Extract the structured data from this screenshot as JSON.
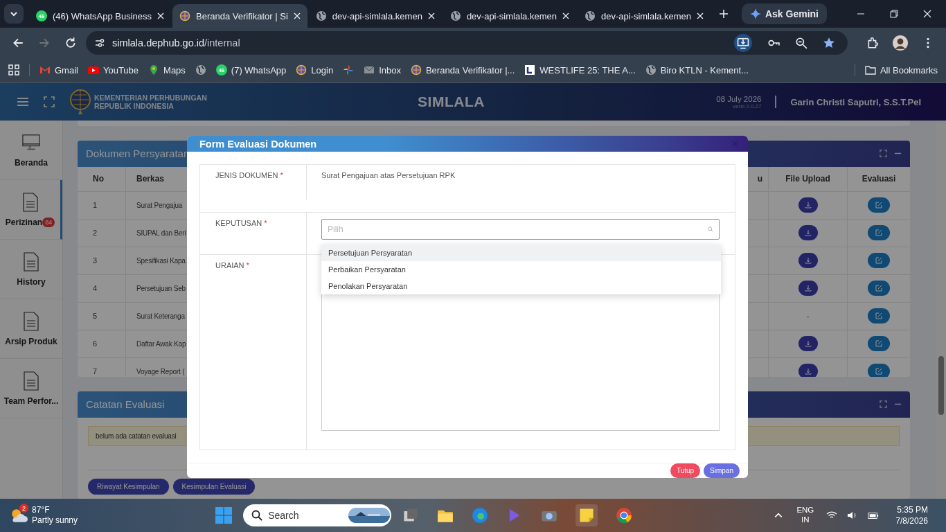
{
  "browser": {
    "tabs": [
      {
        "title": "(46) WhatsApp Business",
        "kind": "whatsapp",
        "badge": "46",
        "selected": false
      },
      {
        "title": "Beranda Verifikator | Si",
        "kind": "emblem",
        "selected": true
      },
      {
        "title": "dev-api-simlala.kemen",
        "kind": "globe",
        "selected": false
      },
      {
        "title": "dev-api-simlala.kemen",
        "kind": "globe",
        "selected": false
      },
      {
        "title": "dev-api-simlala.kemen",
        "kind": "globe",
        "selected": false
      }
    ],
    "gemini": "Ask Gemini",
    "url_host": "simlala.dephub.go.id",
    "url_path": "/internal",
    "bookmarks": [
      {
        "label": "Gmail",
        "kind": "gmail"
      },
      {
        "label": "YouTube",
        "kind": "youtube"
      },
      {
        "label": "Maps",
        "kind": "maps"
      },
      {
        "kind": "globe"
      },
      {
        "label": "(7) WhatsApp",
        "kind": "whatsapp",
        "badge": "46"
      },
      {
        "label": "Login",
        "kind": "emblem"
      },
      {
        "kind": "pinwheel"
      },
      {
        "label": "Inbox",
        "kind": "mail"
      },
      {
        "label": "Beranda Verifikator |...",
        "kind": "emblem"
      },
      {
        "label": "WESTLIFE 25: THE A...",
        "kind": "logo"
      },
      {
        "label": "Biro KTLN - Kement...",
        "kind": "globe"
      }
    ],
    "all_bookmarks": "All Bookmarks"
  },
  "header": {
    "org_line1": "KEMENTERIAN PERHUBUNGAN",
    "org_line2": "REPUBLIK INDONESIA",
    "app_title": "SIMLALA",
    "date": "08 July 2026",
    "version": "versi 2.0.27",
    "user": "Garin Christi Saputri, S.S.T.Pel"
  },
  "sidebar": {
    "items": [
      {
        "label": "Beranda",
        "kind": "monitor",
        "selected": false
      },
      {
        "label": "Perizinan",
        "kind": "document",
        "badge": "84",
        "selected": true
      },
      {
        "label": "History",
        "kind": "document",
        "selected": false
      },
      {
        "label": "Arsip Produk",
        "kind": "document",
        "selected": false
      },
      {
        "label": "Team Perfor...",
        "kind": "document",
        "selected": false
      }
    ]
  },
  "documents_panel": {
    "title": "Dokumen Persyaratan",
    "columns": [
      "No",
      "Berkas",
      "u",
      "File Upload",
      "Evaluasi"
    ],
    "rows": [
      {
        "no": "1",
        "berkas": "Surat Pengajua",
        "has_file": true
      },
      {
        "no": "2",
        "berkas": "SIUPAL dan Beri",
        "has_file": true
      },
      {
        "no": "3",
        "berkas": "Spesifikasi Kapa",
        "has_file": true
      },
      {
        "no": "4",
        "berkas": "Persetujuan Seb",
        "has_file": true
      },
      {
        "no": "5",
        "berkas": "Surat Keteranga",
        "has_file": false,
        "file_text": "-"
      },
      {
        "no": "6",
        "berkas": "Daftar Awak Kap",
        "has_file": true
      },
      {
        "no": "7",
        "berkas": "Voyage Report (",
        "has_file": true
      }
    ]
  },
  "notes_panel": {
    "title": "Catatan Evaluasi",
    "note": "belum ada catatan evaluasi",
    "buttons": [
      "Riwayat Kesimpulan",
      "Kesimpulan Evaluasi"
    ]
  },
  "modal": {
    "title": "Form Evaluasi Dokumen",
    "fields": [
      {
        "label": "JENIS DOKUMEN",
        "required_mark": "*",
        "kind": "text",
        "value": "Surat Pengajuan atas Persetujuan RPK"
      },
      {
        "label": "KEPUTUSAN",
        "required_mark": "*",
        "kind": "select",
        "placeholder": "Pilih",
        "options": [
          {
            "label": "Persetujuan Persyaratan",
            "selected": true
          },
          {
            "label": "Perbaikan Persyaratan",
            "selected": false
          },
          {
            "label": "Penolakan Persyaratan",
            "selected": false
          }
        ]
      },
      {
        "label": "URAIAN",
        "required_mark": "*",
        "kind": "textarea"
      }
    ],
    "close_button": "Tutup",
    "save_button": "Simpan"
  },
  "taskbar": {
    "weather_temp": "87°F",
    "weather_text": "Partly sunny",
    "weather_badge": "2",
    "search": "Search",
    "lang1": "ENG",
    "lang2": "IN",
    "time": "5:35 PM",
    "date": "7/8/2026"
  }
}
